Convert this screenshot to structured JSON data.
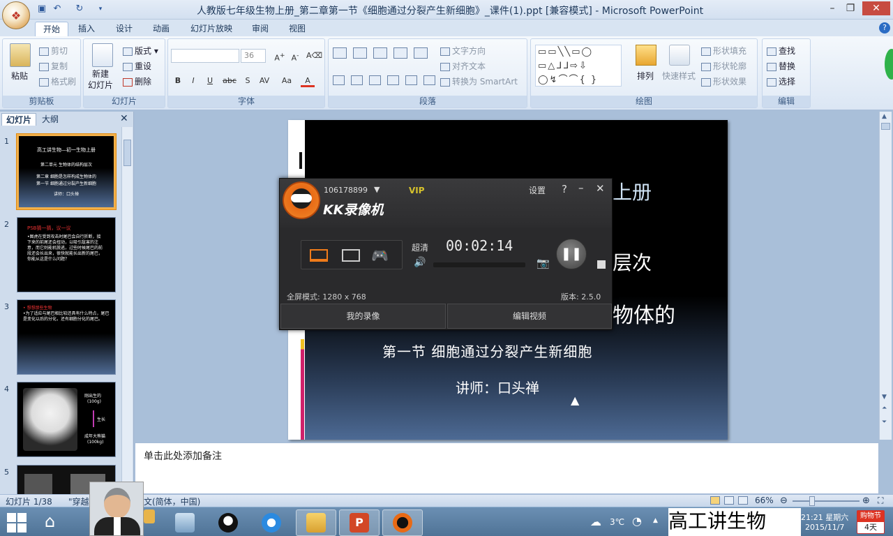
{
  "window": {
    "title": "人教版七年级生物上册_第二章第一节《细胞通过分裂产生新细胞》_课件(1).ppt [兼容模式] - Microsoft PowerPoint"
  },
  "ribbon": {
    "tabs": [
      "开始",
      "插入",
      "设计",
      "动画",
      "幻灯片放映",
      "审阅",
      "视图"
    ],
    "clipboard": {
      "paste": "粘贴",
      "cut": "剪切",
      "copy": "复制",
      "format_painter": "格式刷",
      "label": "剪贴板"
    },
    "slides": {
      "new_slide": "新建\n幻灯片",
      "layout": "版式",
      "reset": "重设",
      "delete": "删除",
      "label": "幻灯片"
    },
    "font": {
      "font_size": "36",
      "bold": "B",
      "italic": "I",
      "underline": "U",
      "strike": "abc",
      "shadow": "S",
      "spacing": "AV",
      "case": "Aa",
      "color": "A",
      "label": "字体"
    },
    "paragraph": {
      "text_direction": "文字方向",
      "align_text": "对齐文本",
      "smartart": "转换为 SmartArt",
      "label": "段落"
    },
    "drawing": {
      "arrange": "排列",
      "quick_styles": "快速样式",
      "shape_fill": "形状填充",
      "shape_outline": "形状轮廓",
      "shape_effects": "形状效果",
      "label": "绘图"
    },
    "editing": {
      "find": "查找",
      "replace": "替换",
      "select": "选择",
      "label": "编辑"
    }
  },
  "left_pane": {
    "tab_slides": "幻灯片",
    "tab_outline": "大纲",
    "thumbnails": [
      {
        "num": "1",
        "lines": [
          "高工讲生物—初一生物上册",
          "第二单元 生物体的结构层次",
          "第二章 细胞是怎样构成生物体的",
          "第一节 细胞通过分裂产生新细胞",
          "讲师：口头禅"
        ]
      },
      {
        "num": "2",
        "lines": [
          "PSB猜一猜，议一议",
          "•图虎在受到攻击时尾巴会自行折断，接下来的前尾还会扭动，以吸引敌害的注意，而它则能机脱逃，过些时候尾巴的前段还会长出来，很快就能长出新的尾巴，你能从这是什么问题？"
        ]
      },
      {
        "num": "3",
        "lines": [
          "• 想想那些生物",
          "•为了适应与尾巴相比较还具有什么特点，尾巴是变化以后的分化，还有细胞分化的尾巴。"
        ]
      },
      {
        "num": "4",
        "lines": [
          "刚出生的",
          "(100g)",
          "生长",
          "成年大熊猫",
          "(100kg)"
        ]
      },
      {
        "num": "5",
        "lines": []
      }
    ]
  },
  "slide": {
    "line1": "上册",
    "line2": "层次",
    "line3": "物体的",
    "line4": "第一节 细胞通过分裂产生新细胞",
    "line5": "讲师：口头禅"
  },
  "notes": {
    "placeholder": "单击此处添加备注"
  },
  "status": {
    "slide_info": "幻灯片 1/38",
    "theme": "\"穿越",
    "lang": "文(简体，中国)",
    "zoom": "66%"
  },
  "kk_recorder": {
    "account": "106178899",
    "vip": "VIP",
    "brand": "KK录像机",
    "settings": "设置",
    "help": "?",
    "quality": "超清",
    "timer": "00:02:14",
    "mode": "全屏模式: 1280 x 768",
    "version": "版本: 2.5.0",
    "my_recordings": "我的录像",
    "edit_video": "编辑视频"
  },
  "taskbar": {
    "weather": "3℃",
    "time": "21:21 星期六",
    "date": "2015/11/7",
    "badge_top": "购物节",
    "badge_bottom": "4天"
  },
  "overlay": {
    "watermark": "高工讲生物"
  }
}
